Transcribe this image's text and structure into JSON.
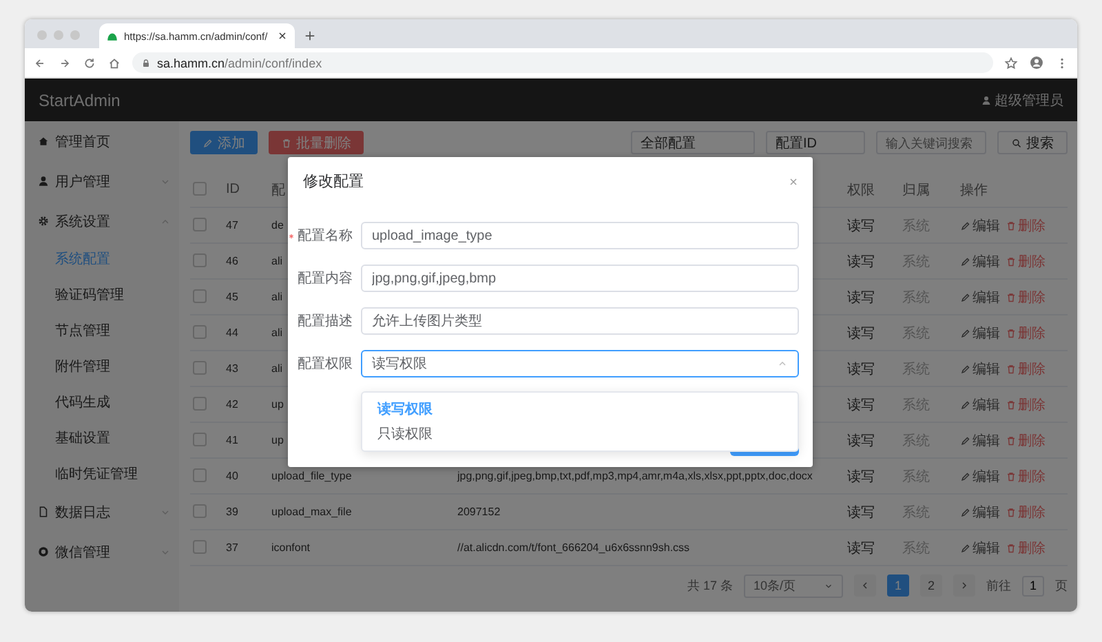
{
  "browser": {
    "tab_title": "https://sa.hamm.cn/admin/conf/",
    "url_host": "sa.hamm.cn",
    "url_path": "/admin/conf/index"
  },
  "header": {
    "brand": "StartAdmin",
    "user": "超级管理员"
  },
  "sidebar": {
    "items": [
      {
        "label": "管理首页",
        "selected": false
      },
      {
        "label": "用户管理",
        "selected": false,
        "expanded": false
      },
      {
        "label": "系统设置",
        "selected": false,
        "expanded": true,
        "children": [
          {
            "label": "系统配置",
            "selected": true
          },
          {
            "label": "验证码管理",
            "selected": false
          },
          {
            "label": "节点管理",
            "selected": false
          },
          {
            "label": "附件管理",
            "selected": false
          },
          {
            "label": "代码生成",
            "selected": false
          },
          {
            "label": "基础设置",
            "selected": false
          },
          {
            "label": "临时凭证管理",
            "selected": false
          }
        ]
      },
      {
        "label": "数据日志",
        "selected": false,
        "expanded": false
      },
      {
        "label": "微信管理",
        "selected": false,
        "expanded": false
      }
    ]
  },
  "toolbar": {
    "add_button": "添加",
    "batch_delete_button": "批量删除",
    "filter": "全部配置",
    "field": "配置ID",
    "search_placeholder": "输入关键词搜索",
    "search_button": "搜索"
  },
  "table": {
    "columns": [
      "ID",
      "配",
      "权限",
      "归属",
      "操作"
    ],
    "all_checked": false,
    "rows": [
      {
        "checked": false,
        "id": "47",
        "name": "de",
        "permission": "读写",
        "owner": "系统",
        "actions": [
          "编辑",
          "删除"
        ]
      },
      {
        "checked": false,
        "id": "46",
        "name": "ali",
        "permission": "读写",
        "owner": "系统",
        "actions": [
          "编辑",
          "删除"
        ]
      },
      {
        "checked": false,
        "id": "45",
        "name": "ali",
        "permission": "读写",
        "owner": "系统",
        "actions": [
          "编辑",
          "删除"
        ]
      },
      {
        "checked": false,
        "id": "44",
        "name": "ali",
        "permission": "读写",
        "owner": "系统",
        "actions": [
          "编辑",
          "删除"
        ]
      },
      {
        "checked": false,
        "id": "43",
        "name": "ali",
        "permission": "读写",
        "owner": "系统",
        "actions": [
          "编辑",
          "删除"
        ]
      },
      {
        "checked": false,
        "id": "42",
        "name": "up",
        "permission": "读写",
        "owner": "系统",
        "actions": [
          "编辑",
          "删除"
        ]
      },
      {
        "checked": false,
        "id": "41",
        "name": "up",
        "permission": "读写",
        "owner": "系统",
        "actions": [
          "编辑",
          "删除"
        ]
      },
      {
        "checked": false,
        "id": "40",
        "name": "upload_file_type",
        "value": "jpg,png,gif,jpeg,bmp,txt,pdf,mp3,mp4,amr,m4a,xls,xlsx,ppt,pptx,doc,docx",
        "permission": "读写",
        "owner": "系统",
        "actions": [
          "编辑",
          "删除"
        ]
      },
      {
        "checked": false,
        "id": "39",
        "name": "upload_max_file",
        "value": "2097152",
        "permission": "读写",
        "owner": "系统",
        "actions": [
          "编辑",
          "删除"
        ]
      },
      {
        "checked": false,
        "id": "37",
        "name": "iconfont",
        "value": "//at.alicdn.com/t/font_666204_u6x6ssnn9sh.css",
        "permission": "读写",
        "owner": "系统",
        "actions": [
          "编辑",
          "删除"
        ]
      }
    ]
  },
  "pagination": {
    "total": "共 17 条",
    "page_size": "10条/页",
    "pages": [
      {
        "label": "1",
        "selected": true
      },
      {
        "label": "2",
        "selected": false
      }
    ],
    "goto_label": "前往",
    "goto_value": "1",
    "page_suffix": "页"
  },
  "modal": {
    "title": "修改配置",
    "fields": [
      {
        "label": "配置名称",
        "required": true,
        "value": "upload_image_type"
      },
      {
        "label": "配置内容",
        "required": false,
        "value": "jpg,png,gif,jpeg,bmp"
      },
      {
        "label": "配置描述",
        "required": false,
        "value": "允许上传图片类型"
      }
    ],
    "select": {
      "label": "配置权限",
      "value": "读写权限",
      "expanded": true,
      "options": [
        {
          "label": "读写权限",
          "selected": true
        },
        {
          "label": "只读权限",
          "selected": false
        }
      ]
    }
  }
}
